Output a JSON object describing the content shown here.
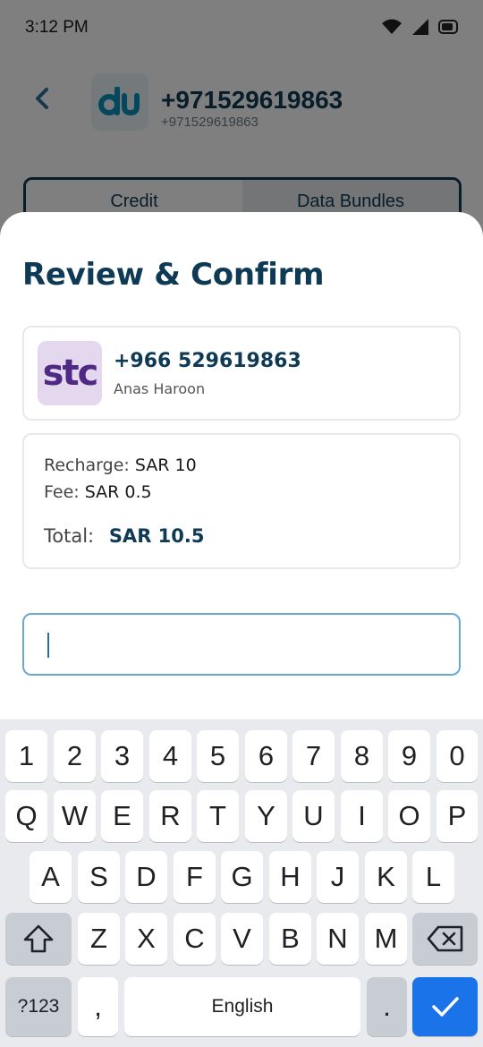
{
  "status_bar": {
    "time": "3:12 PM"
  },
  "background_screen": {
    "number": "+971529619863",
    "sub_number": "+971529619863",
    "tabs": [
      {
        "label": "Credit"
      },
      {
        "label": "Data Bundles"
      }
    ]
  },
  "sheet": {
    "title": "Review & Confirm",
    "recipient": {
      "operator_logo_text": "stc",
      "number": "+966 529619863",
      "name": "Anas Haroon"
    },
    "summary": {
      "recharge_label": "Recharge:",
      "recharge_value": "SAR 10",
      "fee_label": "Fee:",
      "fee_value": "SAR 0.5",
      "total_label": "Total:",
      "total_value": "SAR 10.5"
    },
    "pin_input": {
      "value": "",
      "placeholder": ""
    }
  },
  "keyboard": {
    "row1": [
      "1",
      "2",
      "3",
      "4",
      "5",
      "6",
      "7",
      "8",
      "9",
      "0"
    ],
    "row2": [
      "Q",
      "W",
      "E",
      "R",
      "T",
      "Y",
      "U",
      "I",
      "O",
      "P"
    ],
    "row3": [
      "A",
      "S",
      "D",
      "F",
      "G",
      "H",
      "J",
      "K",
      "L"
    ],
    "row4": [
      "Z",
      "X",
      "C",
      "V",
      "B",
      "N",
      "M"
    ],
    "symbols_label": "?123",
    "comma_label": ",",
    "space_label": "English",
    "period_label": "."
  },
  "colors": {
    "brand_primary": "#0e3a55",
    "accent_blue": "#1a73e8",
    "stc_purple": "#4f2a85"
  }
}
